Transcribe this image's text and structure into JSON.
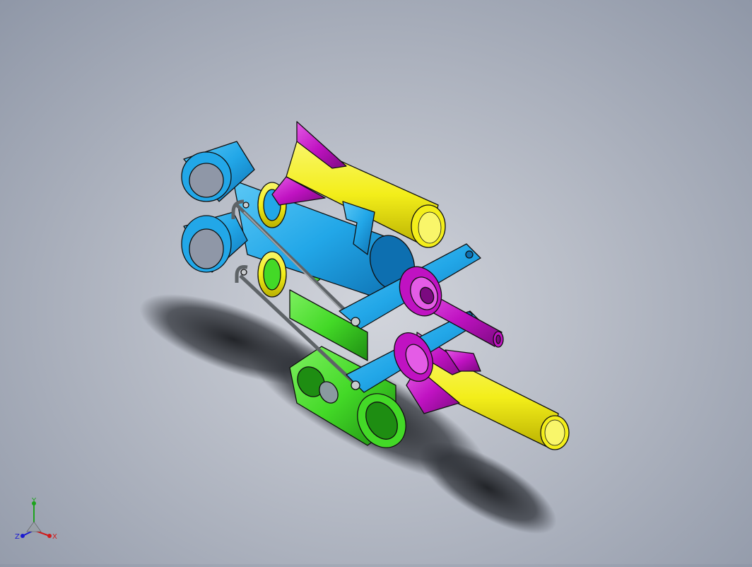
{
  "scene": {
    "description_visible": false,
    "colors": {
      "cyan": "#22a7e8",
      "cyan_dark": "#0d6fb0",
      "yellow": "#f3ee1a",
      "yellow_dark": "#b9b000",
      "magenta": "#c012c2",
      "magenta_dark": "#7b0a80",
      "green": "#43d927",
      "green_dark": "#1e8d12",
      "steel": "#8d9296",
      "outline": "#101010"
    }
  },
  "triad": {
    "x_label": "X",
    "y_label": "Y",
    "z_label": "Z",
    "x_color": "#d11a1a",
    "y_color": "#1da31d",
    "z_color": "#1a1ad1"
  }
}
